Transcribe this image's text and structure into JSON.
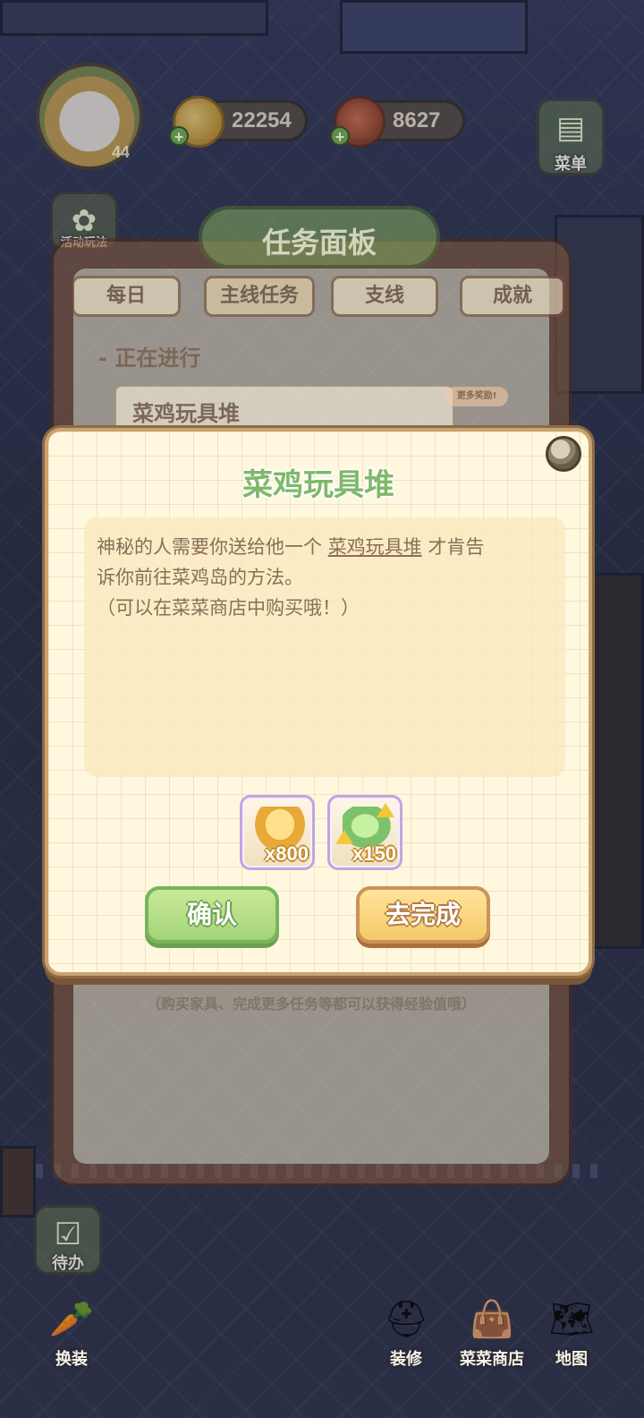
{
  "hud": {
    "level": "44",
    "coins": "22254",
    "meat": "8627",
    "menu_label": "菜单",
    "event_label": "活动玩法"
  },
  "task_panel": {
    "title": "任务面板",
    "tabs": [
      "每日",
      "主线任务",
      "支线",
      "成就"
    ],
    "section": "- 正在进行",
    "current_task": "菜鸡玩具堆",
    "more_rewards": "更多奖励!",
    "hint": "（购买家具、完成更多任务等都可以获得经验值哦）"
  },
  "dialog": {
    "title": "菜鸡玩具堆",
    "desc_line1_a": "神秘的人需要你送给他一个 ",
    "desc_line1_link": "菜鸡玩具堆",
    "desc_line1_b": " 才肯告",
    "desc_line2": "诉你前往菜鸡岛的方法。",
    "desc_line3": "（可以在菜菜商店中购买哦！）",
    "rewards": [
      {
        "icon": "gold-coin-pile-icon",
        "count": "x800"
      },
      {
        "icon": "green-exp-pile-icon",
        "count": "x150"
      }
    ],
    "confirm_label": "确认",
    "go_label": "去完成"
  },
  "side": {
    "todo_label": "待办",
    "dressup_label": "换装"
  },
  "bottom_nav": {
    "decorate_label": "装修",
    "shop_label": "菜菜商店",
    "map_label": "地图"
  }
}
